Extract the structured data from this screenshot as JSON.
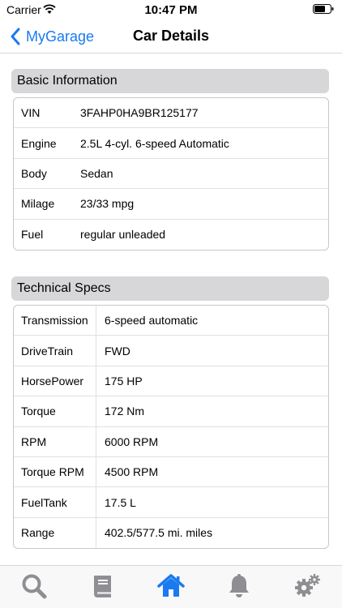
{
  "status_bar": {
    "carrier": "Carrier",
    "time": "10:47 PM",
    "icons": [
      "wifi-icon",
      "battery-icon"
    ]
  },
  "nav": {
    "back_label": "MyGarage",
    "title": "Car Details"
  },
  "basic_info": {
    "title": "Basic Information",
    "rows": [
      {
        "label": "VIN",
        "value": "3FAHP0HA9BR125177"
      },
      {
        "label": "Engine",
        "value": "2.5L 4-cyl. 6-speed Automatic"
      },
      {
        "label": "Body",
        "value": "Sedan"
      },
      {
        "label": "Milage",
        "value": "23/33 mpg"
      },
      {
        "label": "Fuel",
        "value": "regular unleaded"
      }
    ]
  },
  "tech_specs": {
    "title": "Technical Specs",
    "rows": [
      {
        "label": "Transmission",
        "value": "6-speed automatic"
      },
      {
        "label": "DriveTrain",
        "value": "FWD"
      },
      {
        "label": "HorsePower",
        "value": "175 HP"
      },
      {
        "label": "Torque",
        "value": "172 Nm"
      },
      {
        "label": "RPM",
        "value": "6000 RPM"
      },
      {
        "label": "Torque RPM",
        "value": "4500 RPM"
      },
      {
        "label": "FuelTank",
        "value": "17.5 L"
      },
      {
        "label": "Range",
        "value": "402.5/577.5 mi. miles"
      }
    ]
  },
  "tab_bar": {
    "items": [
      {
        "icon": "search-icon",
        "active": false
      },
      {
        "icon": "book-icon",
        "active": false
      },
      {
        "icon": "home-icon",
        "active": true
      },
      {
        "icon": "bell-icon",
        "active": false
      },
      {
        "icon": "gears-icon",
        "active": false
      }
    ],
    "active_color": "#1a7af0",
    "inactive_color": "#8e8e93"
  },
  "colors": {
    "accent": "#1a7af0",
    "section_header_bg": "#d7d7d9"
  }
}
